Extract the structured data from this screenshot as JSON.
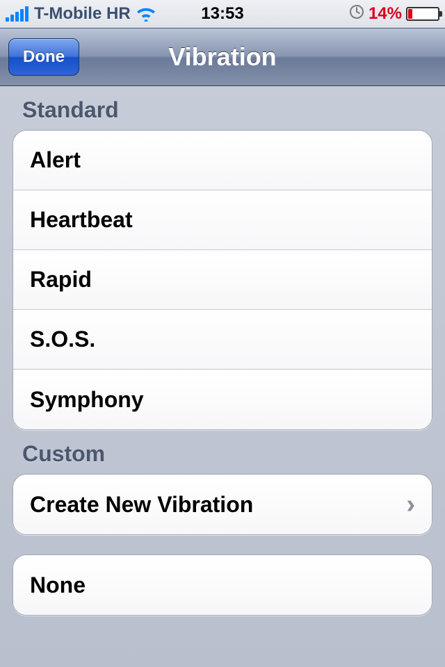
{
  "status_bar": {
    "carrier": "T-Mobile HR",
    "time": "13:53",
    "battery_pct": "14%"
  },
  "nav": {
    "done_label": "Done",
    "title": "Vibration"
  },
  "sections": {
    "standard_header": "Standard",
    "custom_header": "Custom"
  },
  "standard_items": {
    "0": "Alert",
    "1": "Heartbeat",
    "2": "Rapid",
    "3": "S.O.S.",
    "4": "Symphony"
  },
  "custom_items": {
    "create": "Create New Vibration"
  },
  "none_section": {
    "none": "None"
  }
}
